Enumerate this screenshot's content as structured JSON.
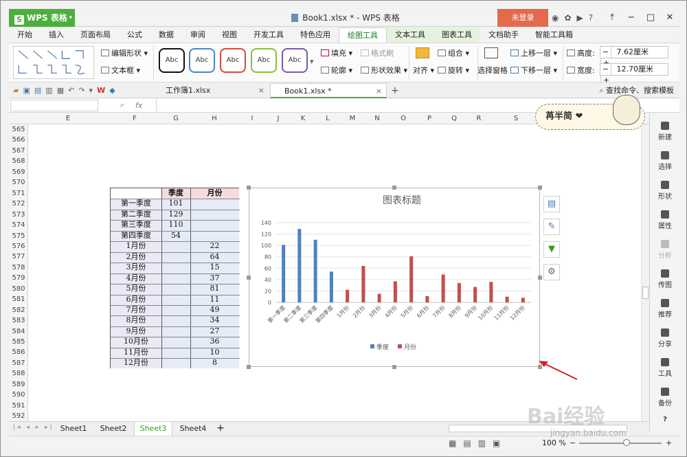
{
  "app": {
    "name": "WPS 表格",
    "window_title": "Book1.xlsx * - WPS 表格",
    "login_label": "未登录"
  },
  "ribbon_tabs": [
    "开始",
    "插入",
    "页面布局",
    "公式",
    "数据",
    "审阅",
    "视图",
    "开发工具",
    "特色应用",
    "绘图工具",
    "文本工具",
    "图表工具",
    "文档助手",
    "智能工具箱"
  ],
  "ribbon": {
    "edit_shape": "编辑形状",
    "text_box": "文本框",
    "style_preset": "Abc",
    "fill": "填充",
    "format_brush": "格式刷",
    "outline": "轮廓",
    "shape_effects": "形状效果",
    "align": "对齐",
    "group": "组合",
    "rotate": "旋转",
    "selection_pane": "选择窗格",
    "bring_forward": "上移一层",
    "send_backward": "下移一层",
    "height_label": "高度:",
    "height_value": "7.62厘米",
    "width_label": "宽度:",
    "width_value": "12.70厘米",
    "minus": "−",
    "plus": "+"
  },
  "file_tabs": [
    {
      "label": "工作簿1.xlsx",
      "close": "×"
    },
    {
      "label": "Book1.xlsx *",
      "close": "×"
    }
  ],
  "new_tab": "+",
  "search_placeholder": "查找命令、搜索模板",
  "formula": {
    "fx": "fx"
  },
  "sticker_text": "苒半简 ❤",
  "columns": [
    "E",
    "F",
    "G",
    "H",
    "I",
    "J",
    "K",
    "L",
    "M",
    "N",
    "O",
    "P",
    "Q",
    "R",
    "S"
  ],
  "rows": [
    "565",
    "566",
    "567",
    "568",
    "569",
    "570",
    "571",
    "572",
    "573",
    "574",
    "575",
    "576",
    "577",
    "578",
    "579",
    "580",
    "581",
    "582",
    "583",
    "584",
    "585",
    "586",
    "587",
    "588",
    "589",
    "590",
    "591",
    "592"
  ],
  "table": {
    "header_quarter": "季度",
    "header_month": "月份",
    "quarters": [
      {
        "label": "第一季度",
        "value": "101"
      },
      {
        "label": "第二季度",
        "value": "129"
      },
      {
        "label": "第三季度",
        "value": "110"
      },
      {
        "label": "第四季度",
        "value": "54"
      }
    ],
    "months": [
      {
        "label": "1月份",
        "value": "22"
      },
      {
        "label": "2月份",
        "value": "64"
      },
      {
        "label": "3月份",
        "value": "15"
      },
      {
        "label": "4月份",
        "value": "37"
      },
      {
        "label": "5月份",
        "value": "81"
      },
      {
        "label": "6月份",
        "value": "11"
      },
      {
        "label": "7月份",
        "value": "49"
      },
      {
        "label": "8月份",
        "value": "34"
      },
      {
        "label": "9月份",
        "value": "27"
      },
      {
        "label": "10月份",
        "value": "36"
      },
      {
        "label": "11月份",
        "value": "10"
      },
      {
        "label": "12月份",
        "value": "8"
      }
    ]
  },
  "chart_data": {
    "type": "bar",
    "title": "图表标题",
    "categories": [
      "第一季度",
      "第二季度",
      "第三季度",
      "第四季度",
      "1月份",
      "2月份",
      "3月份",
      "4月份",
      "5月份",
      "6月份",
      "7月份",
      "8月份",
      "9月份",
      "10月份",
      "11月份",
      "12月份"
    ],
    "series": [
      {
        "name": "季度",
        "color": "#4f81bd",
        "values": [
          101,
          129,
          110,
          54,
          null,
          null,
          null,
          null,
          null,
          null,
          null,
          null,
          null,
          null,
          null,
          null
        ]
      },
      {
        "name": "月份",
        "color": "#c0504d",
        "values": [
          null,
          null,
          null,
          null,
          22,
          64,
          15,
          37,
          81,
          11,
          49,
          34,
          27,
          36,
          10,
          8
        ]
      }
    ],
    "ylim": [
      0,
      140
    ],
    "yticks": [
      0,
      20,
      40,
      60,
      80,
      100,
      120,
      140
    ],
    "grid": true,
    "legend": "bottom"
  },
  "right_panel": [
    "新建",
    "选择",
    "形状",
    "属性",
    "分析",
    "传图",
    "推荐",
    "分享",
    "工具",
    "备份"
  ],
  "sheets": [
    "Sheet1",
    "Sheet2",
    "Sheet3",
    "Sheet4"
  ],
  "active_sheet": "Sheet3",
  "add_sheet": "+",
  "status": {
    "zoom": "100 %"
  },
  "watermark": "Bai经验",
  "watermark_url": "jingyan.baidu.com"
}
